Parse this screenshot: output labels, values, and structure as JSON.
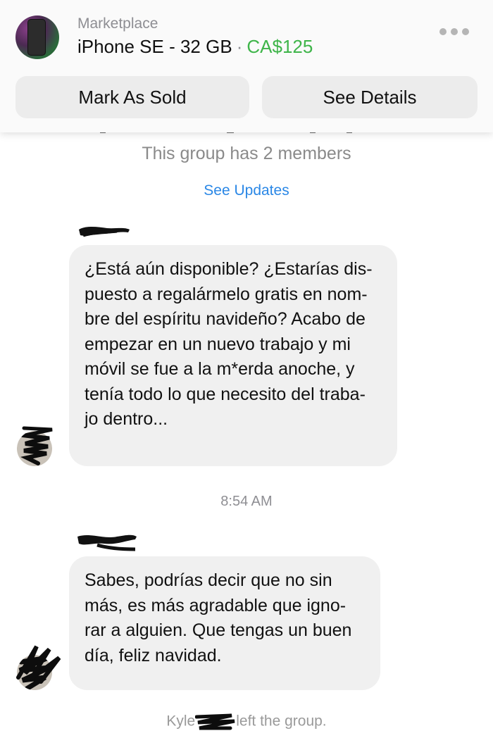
{
  "header": {
    "category": "Marketplace",
    "item_title": "iPhone SE - 32 GB",
    "separator": "·",
    "price": "CA$125",
    "price_color": "#3fb54a",
    "more_icon": "ellipsis-icon",
    "mark_sold_label": "Mark As Sold",
    "see_details_label": "See Details"
  },
  "group": {
    "members_text": "This group has 2 members",
    "see_updates_label": "See Updates",
    "link_color": "#2a87e6"
  },
  "messages": [
    {
      "text": "¿Está aún disponible? ¿Estarías dis-\npuesto a regalármelo gratis en nom-\nbre del espíritu navideño? Acabo de\nempezar en un nuevo trabajo y mi\nmóvil se fue a la m*erda anoche, y\ntenía todo lo que necesito del traba-\njo dentro..."
    },
    {
      "text": "Sabes, podrías decir que no sin\nmás, es más agradable que igno-\nrar a alguien. Que tengas un buen\ndía, feliz navidad."
    }
  ],
  "timestamp": "8:54 AM",
  "left_group": {
    "name": "Kyle",
    "text": "left the group."
  }
}
